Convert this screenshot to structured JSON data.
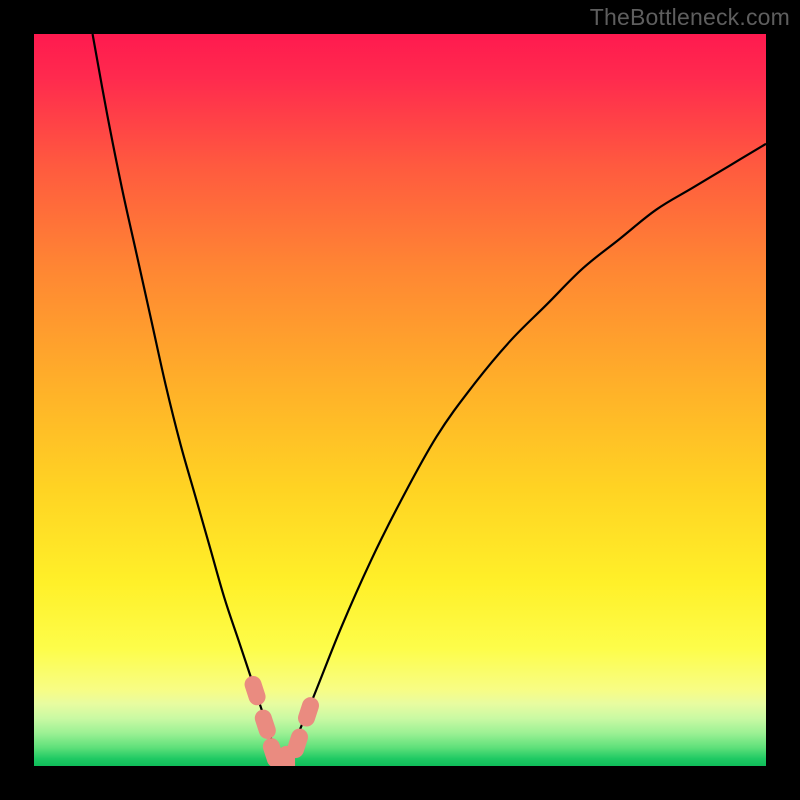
{
  "watermark": "TheBottleneck.com",
  "chart_data": {
    "type": "line",
    "title": "",
    "xlabel": "",
    "ylabel": "",
    "xlim": [
      0,
      100
    ],
    "ylim": [
      0,
      100
    ],
    "series": [
      {
        "name": "bottleneck-curve",
        "x": [
          8,
          10,
          12,
          14,
          16,
          18,
          20,
          22,
          24,
          26,
          28,
          30,
          32,
          33,
          34,
          35,
          38,
          42,
          46,
          50,
          55,
          60,
          65,
          70,
          75,
          80,
          85,
          90,
          95,
          100
        ],
        "y": [
          100,
          89,
          79,
          70,
          61,
          52,
          44,
          37,
          30,
          23,
          17,
          11,
          5,
          2,
          1,
          2,
          9,
          19,
          28,
          36,
          45,
          52,
          58,
          63,
          68,
          72,
          76,
          79,
          82,
          85
        ]
      }
    ],
    "markers": [
      {
        "x": 30.2,
        "y": 10.3
      },
      {
        "x": 31.6,
        "y": 5.7
      },
      {
        "x": 32.7,
        "y": 1.8
      },
      {
        "x": 34.5,
        "y": 0.7
      },
      {
        "x": 36.0,
        "y": 3.1
      },
      {
        "x": 37.5,
        "y": 7.4
      }
    ],
    "gradient_stops": [
      {
        "offset": 0.0,
        "color": "#ff1a4f"
      },
      {
        "offset": 0.06,
        "color": "#ff2a4e"
      },
      {
        "offset": 0.18,
        "color": "#ff5a3f"
      },
      {
        "offset": 0.32,
        "color": "#ff8633"
      },
      {
        "offset": 0.48,
        "color": "#ffb029"
      },
      {
        "offset": 0.62,
        "color": "#ffd323"
      },
      {
        "offset": 0.75,
        "color": "#fff029"
      },
      {
        "offset": 0.84,
        "color": "#fdfd4a"
      },
      {
        "offset": 0.895,
        "color": "#f8fd84"
      },
      {
        "offset": 0.915,
        "color": "#e8fca0"
      },
      {
        "offset": 0.935,
        "color": "#c9f9a3"
      },
      {
        "offset": 0.955,
        "color": "#9cf194"
      },
      {
        "offset": 0.975,
        "color": "#5ee07a"
      },
      {
        "offset": 0.99,
        "color": "#1fc963"
      },
      {
        "offset": 1.0,
        "color": "#0fbd59"
      }
    ],
    "marker_color": "#ea8b80",
    "curve_color": "#000000"
  }
}
